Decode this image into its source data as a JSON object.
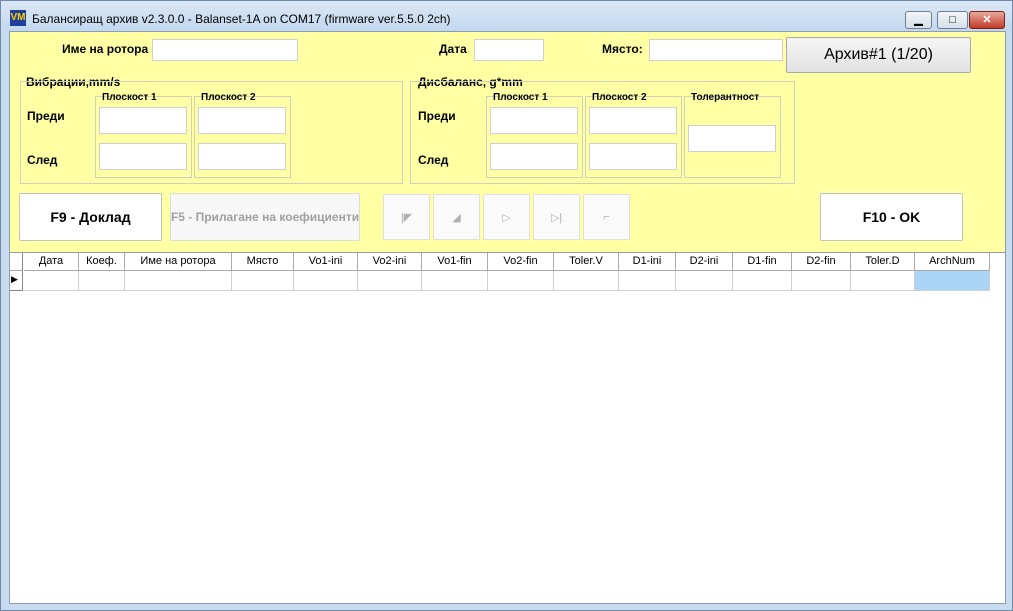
{
  "window": {
    "title": "Балансиращ архив v2.3.0.0 - Balanset-1A on COM17 (firmware ver.5.5.0 2ch)",
    "icon_text": "VM"
  },
  "form": {
    "rotor_name_label": "Име на ротора",
    "rotor_name_value": "",
    "date_label": "Дата",
    "date_value": "",
    "place_label": "Място:",
    "place_value": "",
    "archive_button": "Архив#1 (1/20)"
  },
  "vibration": {
    "title": "Вибрации,mm/s",
    "plane1": "Плоскост 1",
    "plane2": "Плоскост 2",
    "before": "Преди",
    "after": "След"
  },
  "imbalance": {
    "title": "Дисбаланс, g*mm",
    "plane1": "Плоскост 1",
    "plane2": "Плоскост 2",
    "tolerance": "Толерантност",
    "before": "Преди",
    "after": "След"
  },
  "buttons": {
    "report": "F9 - Доклад",
    "apply_coeff": "F5 - Прилагане на коефициенти",
    "ok": "F10 - OK"
  },
  "nav_icons": [
    "first-record-icon",
    "prev-record-icon",
    "next-record-icon",
    "last-record-icon",
    "cancel-record-icon"
  ],
  "table": {
    "columns": [
      "Дата",
      "Коеф.",
      "Име на ротора",
      "Място",
      "Vo1-ini",
      "Vo2-ini",
      "Vo1-fin",
      "Vo2-fin",
      "Toler.V",
      "D1-ini",
      "D2-ini",
      "D1-fin",
      "D2-fin",
      "Toler.D",
      "ArchNum"
    ]
  },
  "colors": {
    "panel_bg": "#ffffa3",
    "selected_cell": "#a7d4f7"
  }
}
